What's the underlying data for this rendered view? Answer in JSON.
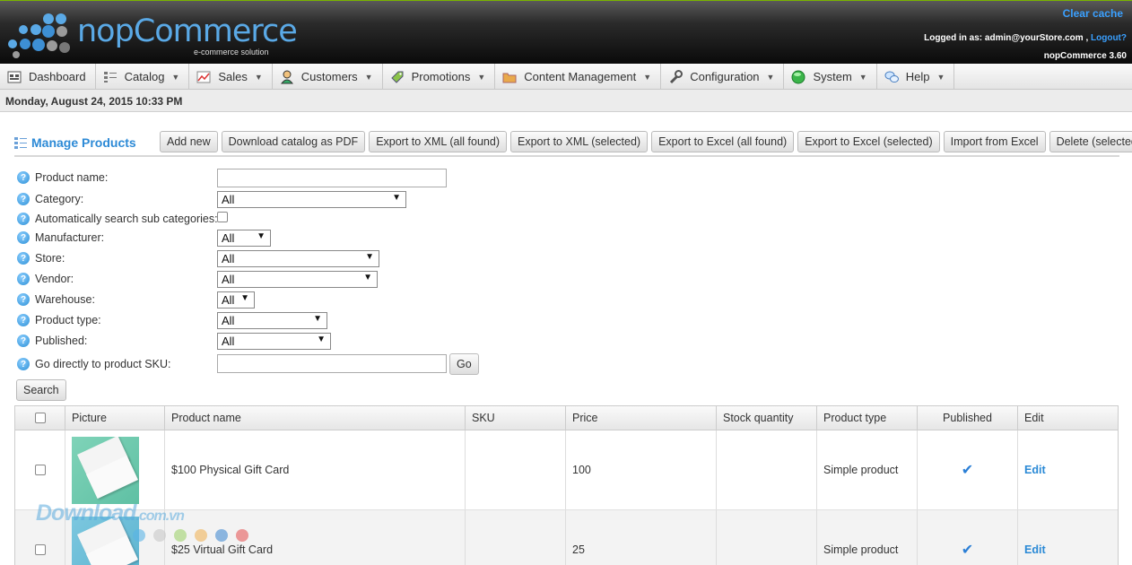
{
  "header": {
    "logo_text": "nopCommerce",
    "logo_sub": "e-commerce solution",
    "clear_cache": "Clear cache",
    "logged_in_prefix": "Logged in as: admin@yourStore.com ,",
    "logout": "Logout?",
    "version": "nopCommerce 3.60"
  },
  "menu": [
    {
      "label": "Dashboard",
      "icon": "dashboard-icon",
      "caret": false
    },
    {
      "label": "Catalog",
      "icon": "catalog-icon",
      "caret": true
    },
    {
      "label": "Sales",
      "icon": "sales-icon",
      "caret": true
    },
    {
      "label": "Customers",
      "icon": "customers-icon",
      "caret": true
    },
    {
      "label": "Promotions",
      "icon": "promotions-icon",
      "caret": true
    },
    {
      "label": "Content Management",
      "icon": "folder-icon",
      "caret": true
    },
    {
      "label": "Configuration",
      "icon": "wrench-icon",
      "caret": true
    },
    {
      "label": "System",
      "icon": "system-icon",
      "caret": true
    },
    {
      "label": "Help",
      "icon": "help-chat-icon",
      "caret": true
    }
  ],
  "date_text": "Monday, August 24, 2015 10:33 PM",
  "page_title": "Manage Products",
  "toolbar": {
    "add_new": "Add new",
    "download_pdf": "Download catalog as PDF",
    "export_xml_all": "Export to XML (all found)",
    "export_xml_selected": "Export to XML (selected)",
    "export_excel_all": "Export to Excel (all found)",
    "export_excel_selected": "Export to Excel (selected)",
    "import_excel": "Import from Excel",
    "delete_selected": "Delete (selected)"
  },
  "form": {
    "product_name_label": "Product name:",
    "product_name_value": "",
    "category_label": "Category:",
    "category_value": "All",
    "search_sub_label": "Automatically search sub categories:",
    "manufacturer_label": "Manufacturer:",
    "manufacturer_value": "All",
    "store_label": "Store:",
    "store_value": "All",
    "vendor_label": "Vendor:",
    "vendor_value": "All",
    "warehouse_label": "Warehouse:",
    "warehouse_value": "All",
    "product_type_label": "Product type:",
    "product_type_value": "All",
    "published_label": "Published:",
    "published_value": "All",
    "sku_label": "Go directly to product SKU:",
    "sku_value": "",
    "go_button": "Go",
    "search_button": "Search"
  },
  "table": {
    "headers": [
      "Picture",
      "Product name",
      "SKU",
      "Price",
      "Stock quantity",
      "Product type",
      "Published",
      "Edit"
    ],
    "rows": [
      {
        "name": "$100 Physical Gift Card",
        "sku": "",
        "price": "100",
        "stock": "",
        "type": "Simple product",
        "published": true,
        "edit": "Edit"
      },
      {
        "name": "$25 Virtual Gift Card",
        "sku": "",
        "price": "25",
        "stock": "",
        "type": "Simple product",
        "published": true,
        "edit": "Edit"
      }
    ]
  },
  "watermark": {
    "main": "Download",
    "suffix": ".com.vn"
  },
  "colors": {
    "accent": "#2b8ad6",
    "header_dark": "#0a0a0a",
    "link": "#3aa0ff"
  }
}
